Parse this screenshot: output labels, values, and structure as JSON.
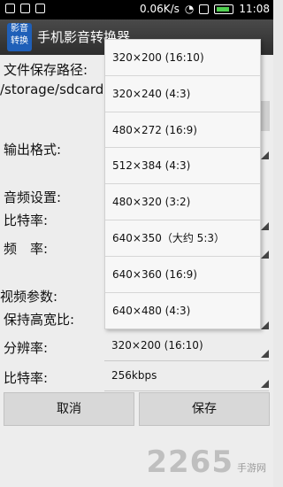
{
  "status_bar": {
    "speed": "0.06K/s",
    "time": "11:08"
  },
  "app": {
    "icon_text_top": "影音",
    "icon_text_bottom": "转换",
    "title": "手机影音转换器"
  },
  "form": {
    "save_path_label": "文件保存路径:",
    "save_path_value": "/storage/sdcard",
    "output_format_label": "输出格式:",
    "audio_settings_label": "音频设置:",
    "audio_bitrate_label": "比特率:",
    "audio_frequency_label": "频　率:",
    "video_params_label": "视频参数:",
    "keep_aspect_label": "保持高宽比:",
    "resolution_label": "分辨率:",
    "resolution_value": "320×200 (16:10)",
    "video_bitrate_label": "比特率:",
    "video_bitrate_value": "256kbps"
  },
  "buttons": {
    "cancel": "取消",
    "save": "保存"
  },
  "dropdown": {
    "options": [
      "320×200 (16:10)",
      "320×240 (4:3)",
      "480×272 (16:9)",
      "512×384 (4:3)",
      "480×320 (3:2)",
      "640×350（大约 5:3）",
      "640×360 (16:9)",
      "640×480 (4:3)"
    ]
  },
  "watermark": {
    "brand": "2265",
    "site": "手游网"
  }
}
